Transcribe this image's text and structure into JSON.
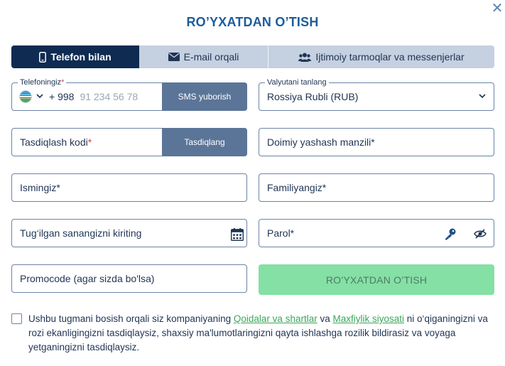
{
  "title": "RO’YXATDAN O’TISH",
  "close_icon": "close-icon",
  "tabs": [
    {
      "label": "Telefon bilan",
      "icon": "phone-icon",
      "active": true
    },
    {
      "label": "E-mail orqali",
      "icon": "envelope-icon",
      "active": false
    },
    {
      "label": "Ijtimoiy tarmoqlar va messenjerlar",
      "icon": "users-icon",
      "active": false
    }
  ],
  "phone": {
    "label": "Telefoningiz",
    "required_mark": "*",
    "country_code": "+ 998",
    "placeholder": "91 234 56 78",
    "button": "SMS yuborish"
  },
  "currency": {
    "label": "Valyutani tanlang",
    "value": "Rossiya Rubli (RUB)"
  },
  "confirm_code": {
    "placeholder": "Tasdiqlash kodi",
    "required_mark": "*",
    "button": "Tasdiqlang"
  },
  "address": {
    "placeholder": "Doimiy yashash manzili*"
  },
  "first_name": {
    "placeholder": "Ismingiz*"
  },
  "last_name": {
    "placeholder": "Familiyangiz*"
  },
  "birthdate": {
    "placeholder": "Tug‘ilgan sanangizni kiriting"
  },
  "password": {
    "placeholder": "Parol*"
  },
  "promo": {
    "placeholder": "Promocode (agar sizda bo'lsa)"
  },
  "submit": "RO’YXATDAN O’TISH",
  "agreement": {
    "part1": "Ushbu tugmani bosish orqali siz kompaniyaning ",
    "link1": "Qoidalar va shartlar",
    "part2": " va ",
    "link2": "Maxfiylik siyosati",
    "part3": " ni o‘qiganingizni va rozi ekanligingizni tasdiqlaysiz, shaxsiy ma'lumotlaringizni qayta ishlashga rozilik bildirasiz va voyaga yetganingizni tasdiqlaysiz."
  },
  "colors": {
    "title": "#1d5c9a",
    "tab_active": "#0f2b52",
    "tab_inactive": "#c5d0e0",
    "submit_bg": "#85e0a5",
    "link": "#39a85a",
    "required": "#d63f3f"
  }
}
